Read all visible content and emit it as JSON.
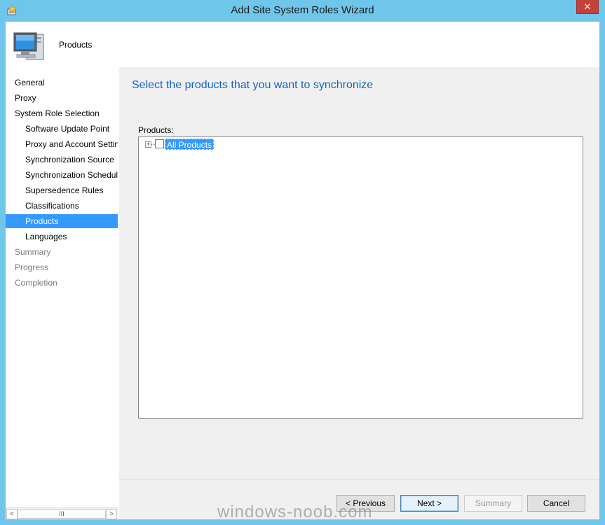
{
  "window": {
    "title": "Add Site System Roles Wizard",
    "close_glyph": "✕"
  },
  "header": {
    "title": "Products",
    "icon": "computer-icon"
  },
  "nav": {
    "items": [
      {
        "label": "General",
        "state": "visited"
      },
      {
        "label": "Proxy",
        "state": "visited"
      },
      {
        "label": "System Role Selection",
        "state": "visited"
      },
      {
        "label": "Software Update Point",
        "state": "visited"
      },
      {
        "label": "Proxy and Account Settings",
        "state": "visited"
      },
      {
        "label": "Synchronization Source",
        "state": "visited"
      },
      {
        "label": "Synchronization Schedule",
        "state": "visited"
      },
      {
        "label": "Supersedence Rules",
        "state": "visited"
      },
      {
        "label": "Classifications",
        "state": "visited"
      },
      {
        "label": "Products",
        "state": "selected"
      },
      {
        "label": "Languages",
        "state": "visited"
      },
      {
        "label": "Summary",
        "state": "disabled"
      },
      {
        "label": "Progress",
        "state": "disabled"
      },
      {
        "label": "Completion",
        "state": "disabled"
      }
    ]
  },
  "scrollbar": {
    "left_arrow": "<",
    "thumb_grip": "III",
    "right_arrow": ">"
  },
  "page": {
    "heading": "Select the products that you want to synchronize",
    "products_label": "Products:",
    "tree": {
      "expander": "+",
      "root_label": "All Products",
      "root_checked": false
    }
  },
  "buttons": {
    "previous": "< Previous",
    "next": "Next >",
    "summary": "Summary",
    "cancel": "Cancel"
  },
  "watermark": "windows-noob.com",
  "colors": {
    "title_bar": "#6ec6ea",
    "selection": "#3399ff",
    "heading": "#1565c0",
    "close_button": "#c7413c"
  }
}
